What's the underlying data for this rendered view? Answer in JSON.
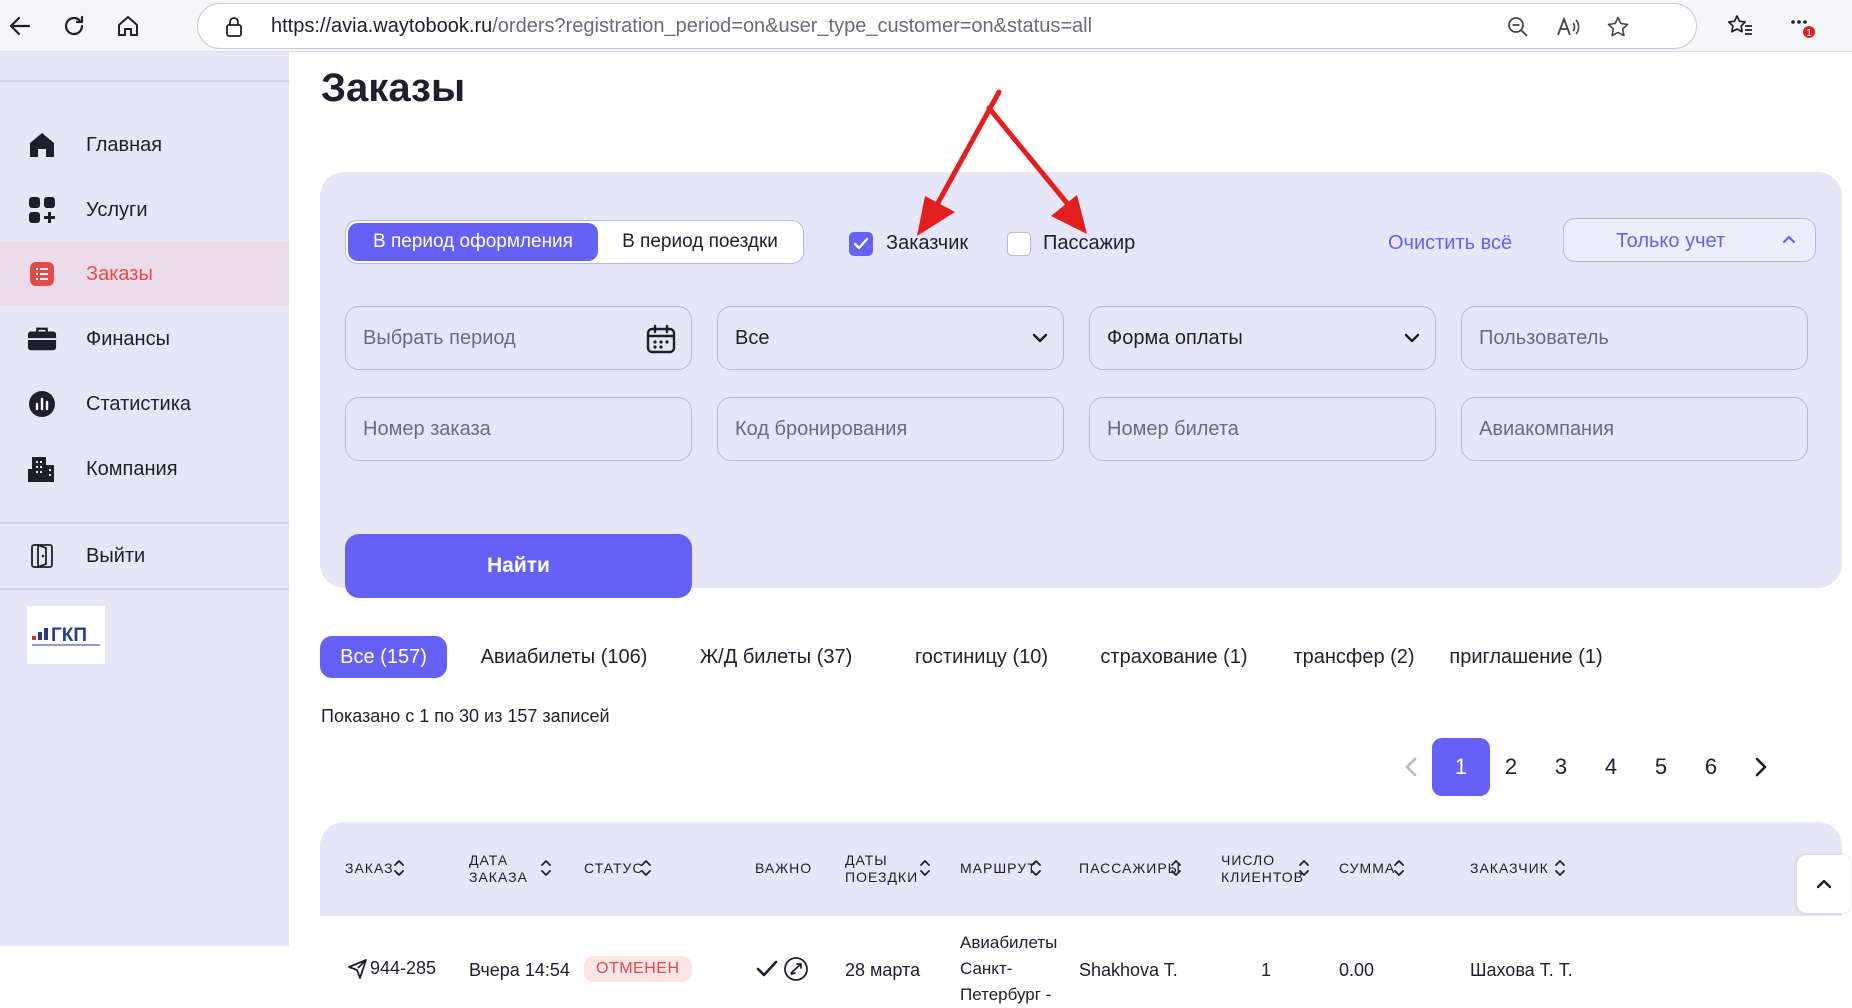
{
  "browser": {
    "url_host": "https://avia.waytobook.ru",
    "url_path": "/orders?registration_period=on&user_type_customer=on&status=all",
    "notification_count": "1"
  },
  "sidebar": {
    "items": [
      {
        "label": "Главная",
        "icon": "home-icon"
      },
      {
        "label": "Услуги",
        "icon": "services-icon"
      },
      {
        "label": "Заказы",
        "icon": "orders-icon",
        "active": true
      },
      {
        "label": "Финансы",
        "icon": "briefcase-icon"
      },
      {
        "label": "Статистика",
        "icon": "stats-icon"
      },
      {
        "label": "Компания",
        "icon": "building-icon"
      },
      {
        "label": "Выйти",
        "icon": "logout-icon"
      }
    ],
    "logo_text": "ГКП"
  },
  "page": {
    "title": "Заказы"
  },
  "filters": {
    "period_registration": "В период оформления",
    "period_trip": "В период поездки",
    "customer_label": "Заказчик",
    "customer_checked": true,
    "passenger_label": "Пассажир",
    "passenger_checked": false,
    "clear_all": "Очистить всё",
    "accounting_dropdown": "Только учет",
    "period_placeholder": "Выбрать период",
    "status_value": "Все",
    "payment_form_value": "Форма оплаты",
    "user_placeholder": "Пользователь",
    "order_number_placeholder": "Номер заказа",
    "booking_code_placeholder": "Код бронирования",
    "ticket_number_placeholder": "Номер билета",
    "airline_placeholder": "Авиакомпания",
    "find_button": "Найти"
  },
  "tabs": [
    {
      "label": "Все (157)",
      "active": true
    },
    {
      "label": "Авиабилеты (106)"
    },
    {
      "label": "Ж/Д билеты (37)"
    },
    {
      "label": "гостиницу (10)"
    },
    {
      "label": "страхование (1)"
    },
    {
      "label": "трансфер (2)"
    },
    {
      "label": "приглашение (1)"
    }
  ],
  "pagination": {
    "shown_text": "Показано с 1 по 30 из 157 записей",
    "pages": [
      "1",
      "2",
      "3",
      "4",
      "5",
      "6"
    ],
    "current": "1"
  },
  "table": {
    "headers": {
      "order": "Заказ",
      "order_date_1": "Дата",
      "order_date_2": "заказа",
      "status": "Статус",
      "important": "Важно",
      "trip_dates_1": "Даты",
      "trip_dates_2": "поездки",
      "route": "Маршрут",
      "passengers": "Пассажиры",
      "clients_1": "Число",
      "clients_2": "клиентов",
      "sum": "Сумма",
      "customer": "Заказчик"
    },
    "rows": [
      {
        "order": "944-285",
        "order_date": "Вчера 14:54",
        "status": "ОТМЕНЕН",
        "trip_dates": "28 марта",
        "route_1": "Авиабилеты",
        "route_2": "Санкт-",
        "route_3": "Петербург -",
        "passengers": "Shakhova T.",
        "clients": "1",
        "sum": "0.00",
        "customer": "Шахова Т. Т."
      }
    ]
  },
  "colors": {
    "accent": "#6461f4",
    "sidebar_bg": "#e7e6f7",
    "active_red": "#e34b4b",
    "annotation_arrow": "#e21f1f"
  }
}
